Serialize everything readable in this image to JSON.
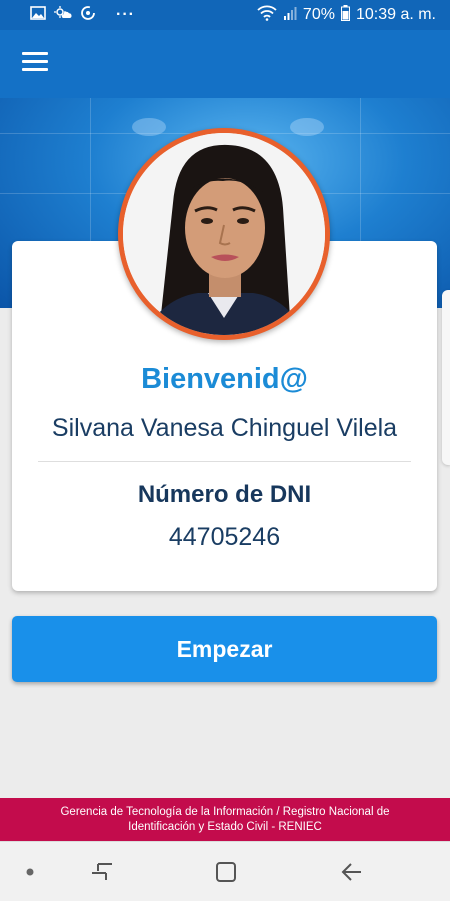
{
  "status_bar": {
    "battery_percent": "70%",
    "time": "10:39 a. m.",
    "more_dots": "···"
  },
  "app_bar": {
    "menu_icon": "hamburger-menu-icon"
  },
  "card": {
    "welcome": "Bienvenid@",
    "full_name": "Silvana Vanesa Chinguel Vilela",
    "dni_label": "Número de DNI",
    "dni_number": "44705246"
  },
  "actions": {
    "start_label": "Empezar"
  },
  "footer": {
    "line1": "Gerencia de Tecnología de la Información / Registro Nacional de",
    "line2": "Identificación y Estado Civil - RENIEC"
  },
  "colors": {
    "primary": "#1471c6",
    "accent": "#1990ea",
    "welcome_text": "#1b8bd6",
    "avatar_ring": "#e8602c",
    "footer": "#c30c4c"
  }
}
